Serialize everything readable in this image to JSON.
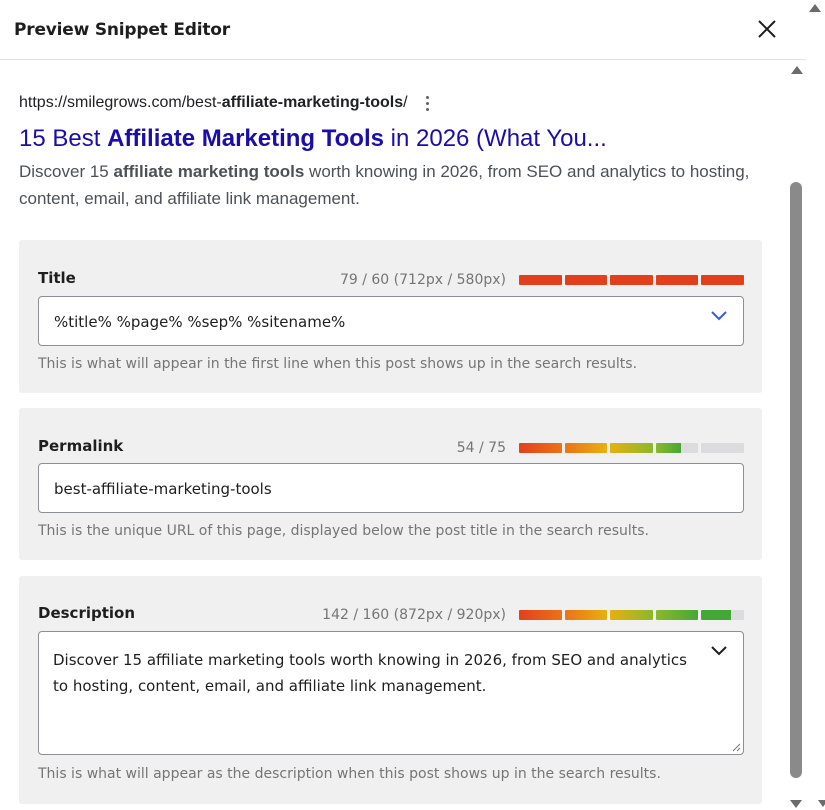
{
  "modal": {
    "title": "Preview Snippet Editor"
  },
  "serp": {
    "url_prefix": "https://smilegrows.com/best-",
    "url_bold": "affiliate-marketing-tools",
    "url_suffix": "/",
    "title_prefix": "15 Best ",
    "title_bold": "Affiliate Marketing Tools",
    "title_suffix": " in 2026 (What You...",
    "desc_prefix": "Discover 15 ",
    "desc_bold": "affiliate marketing tools",
    "desc_suffix": " worth knowing in 2026, from SEO and analytics to hosting, content, email, and affiliate link management."
  },
  "title_panel": {
    "label": "Title",
    "count": "79 / 60 (712px / 580px)",
    "meter_fill": 1.0,
    "value": "%title% %page% %sep% %sitename%",
    "help": "This is what will appear in the first line when this post shows up in the search results."
  },
  "permalink_panel": {
    "label": "Permalink",
    "count": "54 / 75",
    "meter_fill": 0.72,
    "value": "best-affiliate-marketing-tools",
    "help": "This is the unique URL of this page, displayed below the post title in the search results."
  },
  "description_panel": {
    "label": "Description",
    "count": "142 / 160 (872px / 920px)",
    "meter_fill": 0.94,
    "value": "Discover 15 affiliate marketing tools worth knowing in 2026, from SEO and analytics to hosting, content, email, and affiliate link management.",
    "help": "This is what will appear as the description when this post shows up in the search results."
  },
  "colors": {
    "serp_title": "#1a0dab",
    "meter_red": "#e2401c",
    "meter_orange": "#ea7317",
    "meter_yellow": "#e6b10f",
    "meter_lightgreen": "#8bb82c",
    "meter_green": "#44a836",
    "meter_empty": "#dcdcde"
  },
  "icons": [
    "close-icon",
    "more-vertical-icon",
    "chevron-down-icon",
    "resize-handle-icon"
  ]
}
